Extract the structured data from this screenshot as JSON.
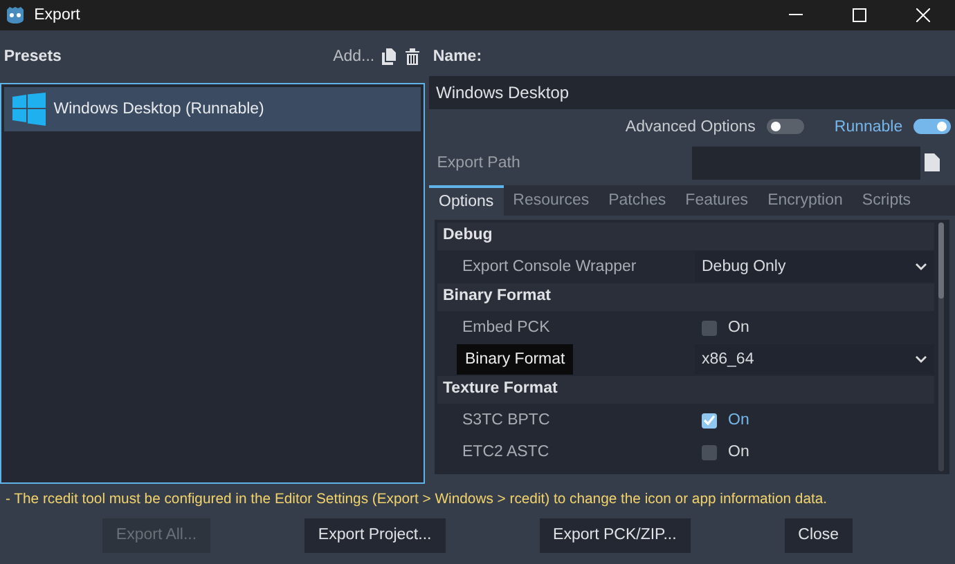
{
  "window": {
    "title": "Export"
  },
  "presets": {
    "title": "Presets",
    "add_label": "Add...",
    "items": [
      {
        "label": "Windows Desktop (Runnable)",
        "selected": true
      }
    ]
  },
  "name": {
    "label": "Name:",
    "value": "Windows Desktop"
  },
  "toggles": [
    {
      "label": "Advanced Options",
      "on": false
    },
    {
      "label": "Runnable",
      "on": true
    }
  ],
  "export_path": {
    "label": "Export Path"
  },
  "tabs": [
    {
      "label": "Options",
      "selected": true
    },
    {
      "label": "Resources",
      "selected": false
    },
    {
      "label": "Patches",
      "selected": false
    },
    {
      "label": "Features",
      "selected": false
    },
    {
      "label": "Encryption",
      "selected": false
    },
    {
      "label": "Scripts",
      "selected": false
    }
  ],
  "options": [
    {
      "kind": "section",
      "label": "Debug"
    },
    {
      "kind": "dropdown",
      "label": "Export Console Wrapper",
      "value": "Debug Only",
      "hovered": false
    },
    {
      "kind": "section",
      "label": "Binary Format"
    },
    {
      "kind": "checkbox",
      "label": "Embed PCK",
      "value": "On",
      "checked": false
    },
    {
      "kind": "dropdown",
      "label": "Binary Format",
      "value": "x86_64",
      "hovered": true
    },
    {
      "kind": "section",
      "label": "Texture Format"
    },
    {
      "kind": "checkbox",
      "label": "S3TC BPTC",
      "value": "On",
      "checked": true
    },
    {
      "kind": "checkbox",
      "label": "ETC2 ASTC",
      "value": "On",
      "checked": false
    }
  ],
  "warning": "- The rcedit tool must be configured in the Editor Settings (Export > Windows > rcedit) to change the icon or app information data.",
  "buttons": [
    {
      "label": "Export All...",
      "disabled": true
    },
    {
      "label": "Export Project...",
      "disabled": false
    },
    {
      "label": "Export PCK/ZIP...",
      "disabled": false
    },
    {
      "label": "Close",
      "disabled": false
    }
  ]
}
